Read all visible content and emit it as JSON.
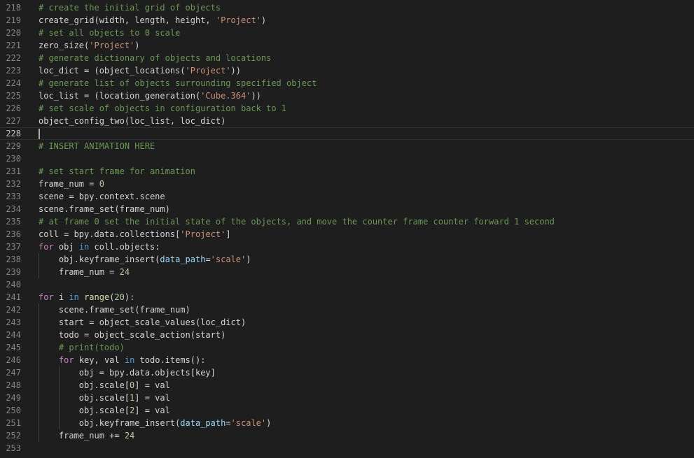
{
  "editor": {
    "current_line": 228,
    "colors": {
      "background": "#1e1e1e",
      "line_number": "#858585",
      "plain": "#d4d4d4",
      "comment": "#6a9955",
      "string": "#ce9178",
      "number": "#b5cea8",
      "keyword": "#569cd6",
      "control": "#c586c0",
      "function": "#dcdcaa",
      "parameter": "#9cdcfe"
    },
    "lines": [
      {
        "number": "218",
        "indent": 0,
        "tokens": [
          {
            "t": "# create the initial grid of objects",
            "c": "comment"
          }
        ]
      },
      {
        "number": "219",
        "indent": 0,
        "tokens": [
          {
            "t": "create_grid(width, length, height, ",
            "c": "plain"
          },
          {
            "t": "'Project'",
            "c": "string"
          },
          {
            "t": ")",
            "c": "plain"
          }
        ]
      },
      {
        "number": "220",
        "indent": 0,
        "tokens": [
          {
            "t": "# set all objects to 0 scale",
            "c": "comment"
          }
        ]
      },
      {
        "number": "221",
        "indent": 0,
        "tokens": [
          {
            "t": "zero_size(",
            "c": "plain"
          },
          {
            "t": "'Project'",
            "c": "string"
          },
          {
            "t": ")",
            "c": "plain"
          }
        ]
      },
      {
        "number": "222",
        "indent": 0,
        "tokens": [
          {
            "t": "# generate dictionary of objects and locations",
            "c": "comment"
          }
        ]
      },
      {
        "number": "223",
        "indent": 0,
        "tokens": [
          {
            "t": "loc_dict = (object_locations(",
            "c": "plain"
          },
          {
            "t": "'Project'",
            "c": "string"
          },
          {
            "t": "))",
            "c": "plain"
          }
        ]
      },
      {
        "number": "224",
        "indent": 0,
        "tokens": [
          {
            "t": "# generate list of objects surrounding specified object",
            "c": "comment"
          }
        ]
      },
      {
        "number": "225",
        "indent": 0,
        "tokens": [
          {
            "t": "loc_list = (location_generation(",
            "c": "plain"
          },
          {
            "t": "'Cube.364'",
            "c": "string"
          },
          {
            "t": "))",
            "c": "plain"
          }
        ]
      },
      {
        "number": "226",
        "indent": 0,
        "tokens": [
          {
            "t": "# set scale of objects in configuration back to 1",
            "c": "comment"
          }
        ]
      },
      {
        "number": "227",
        "indent": 0,
        "tokens": [
          {
            "t": "object_config_two(loc_list, loc_dict)",
            "c": "plain"
          }
        ]
      },
      {
        "number": "228",
        "indent": 0,
        "tokens": []
      },
      {
        "number": "229",
        "indent": 0,
        "tokens": [
          {
            "t": "# INSERT ANIMATION HERE",
            "c": "comment"
          }
        ]
      },
      {
        "number": "230",
        "indent": 0,
        "tokens": []
      },
      {
        "number": "231",
        "indent": 0,
        "tokens": [
          {
            "t": "# set start frame for animation",
            "c": "comment"
          }
        ]
      },
      {
        "number": "232",
        "indent": 0,
        "tokens": [
          {
            "t": "frame_num = ",
            "c": "plain"
          },
          {
            "t": "0",
            "c": "number"
          }
        ]
      },
      {
        "number": "233",
        "indent": 0,
        "tokens": [
          {
            "t": "scene = bpy.context.scene",
            "c": "plain"
          }
        ]
      },
      {
        "number": "234",
        "indent": 0,
        "tokens": [
          {
            "t": "scene.frame_set(frame_num)",
            "c": "plain"
          }
        ]
      },
      {
        "number": "235",
        "indent": 0,
        "tokens": [
          {
            "t": "# at frame 0 set the initial state of the objects, and move the counter frame counter forward 1 second",
            "c": "comment"
          }
        ]
      },
      {
        "number": "236",
        "indent": 0,
        "tokens": [
          {
            "t": "coll = bpy.data.collections[",
            "c": "plain"
          },
          {
            "t": "'Project'",
            "c": "string"
          },
          {
            "t": "]",
            "c": "plain"
          }
        ]
      },
      {
        "number": "237",
        "indent": 0,
        "tokens": [
          {
            "t": "for",
            "c": "control"
          },
          {
            "t": " obj ",
            "c": "plain"
          },
          {
            "t": "in",
            "c": "keyword"
          },
          {
            "t": " coll.objects:",
            "c": "plain"
          }
        ]
      },
      {
        "number": "238",
        "indent": 1,
        "tokens": [
          {
            "t": "obj.keyframe_insert(",
            "c": "plain"
          },
          {
            "t": "data_path",
            "c": "parameter"
          },
          {
            "t": "=",
            "c": "plain"
          },
          {
            "t": "'scale'",
            "c": "string"
          },
          {
            "t": ")",
            "c": "plain"
          }
        ]
      },
      {
        "number": "239",
        "indent": 1,
        "tokens": [
          {
            "t": "frame_num = ",
            "c": "plain"
          },
          {
            "t": "24",
            "c": "number"
          }
        ]
      },
      {
        "number": "240",
        "indent": 0,
        "tokens": []
      },
      {
        "number": "241",
        "indent": 0,
        "tokens": [
          {
            "t": "for",
            "c": "control"
          },
          {
            "t": " i ",
            "c": "plain"
          },
          {
            "t": "in",
            "c": "keyword"
          },
          {
            "t": " ",
            "c": "plain"
          },
          {
            "t": "range",
            "c": "function"
          },
          {
            "t": "(",
            "c": "plain"
          },
          {
            "t": "20",
            "c": "number"
          },
          {
            "t": "):",
            "c": "plain"
          }
        ]
      },
      {
        "number": "242",
        "indent": 1,
        "tokens": [
          {
            "t": "scene.frame_set(frame_num)",
            "c": "plain"
          }
        ]
      },
      {
        "number": "243",
        "indent": 1,
        "tokens": [
          {
            "t": "start = object_scale_values(loc_dict)",
            "c": "plain"
          }
        ]
      },
      {
        "number": "244",
        "indent": 1,
        "tokens": [
          {
            "t": "todo = object_scale_action(start)",
            "c": "plain"
          }
        ]
      },
      {
        "number": "245",
        "indent": 1,
        "tokens": [
          {
            "t": "# print(todo)",
            "c": "comment"
          }
        ]
      },
      {
        "number": "246",
        "indent": 1,
        "tokens": [
          {
            "t": "for",
            "c": "control"
          },
          {
            "t": " key, val ",
            "c": "plain"
          },
          {
            "t": "in",
            "c": "keyword"
          },
          {
            "t": " todo.items():",
            "c": "plain"
          }
        ]
      },
      {
        "number": "247",
        "indent": 2,
        "tokens": [
          {
            "t": "obj = bpy.data.objects[key]",
            "c": "plain"
          }
        ]
      },
      {
        "number": "248",
        "indent": 2,
        "tokens": [
          {
            "t": "obj.scale[",
            "c": "plain"
          },
          {
            "t": "0",
            "c": "number"
          },
          {
            "t": "] = val",
            "c": "plain"
          }
        ]
      },
      {
        "number": "249",
        "indent": 2,
        "tokens": [
          {
            "t": "obj.scale[",
            "c": "plain"
          },
          {
            "t": "1",
            "c": "number"
          },
          {
            "t": "] = val",
            "c": "plain"
          }
        ]
      },
      {
        "number": "250",
        "indent": 2,
        "tokens": [
          {
            "t": "obj.scale[",
            "c": "plain"
          },
          {
            "t": "2",
            "c": "number"
          },
          {
            "t": "] = val",
            "c": "plain"
          }
        ]
      },
      {
        "number": "251",
        "indent": 2,
        "tokens": [
          {
            "t": "obj.keyframe_insert(",
            "c": "plain"
          },
          {
            "t": "data_path",
            "c": "parameter"
          },
          {
            "t": "=",
            "c": "plain"
          },
          {
            "t": "'scale'",
            "c": "string"
          },
          {
            "t": ")",
            "c": "plain"
          }
        ]
      },
      {
        "number": "252",
        "indent": 1,
        "tokens": [
          {
            "t": "frame_num += ",
            "c": "plain"
          },
          {
            "t": "24",
            "c": "number"
          }
        ]
      },
      {
        "number": "253",
        "indent": 0,
        "tokens": []
      }
    ]
  }
}
